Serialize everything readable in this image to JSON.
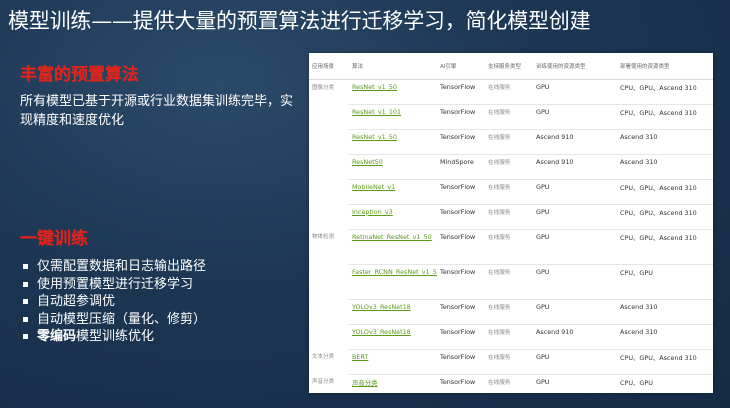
{
  "title": "模型训练——提供大量的预置算法进行迁移学习，简化模型创建",
  "section1": {
    "heading": "丰富的预置算法",
    "description": "所有模型已基于开源或行业数据集训练完毕，实现精度和速度优化"
  },
  "section2": {
    "heading": "一键训练",
    "bullets": [
      {
        "text": "仅需配置数据和日志输出路径"
      },
      {
        "text": "使用预置模型进行迁移学习"
      },
      {
        "text": "自动超参调优"
      },
      {
        "text": "自动模型压缩（量化、修剪）"
      },
      {
        "bold": "零编码",
        "text": "模型训练优化"
      }
    ]
  },
  "table": {
    "headers": [
      "应用场景",
      "算法",
      "AI引擎",
      "支持服务类型",
      "训练使用的资源类型",
      "部署使用的资源类型"
    ],
    "rows": [
      {
        "scene": "图像分类",
        "algo": "ResNet_v1_50",
        "engine": "TensorFlow",
        "service": "在线服务",
        "train": "GPU",
        "deploy": "CPU、GPU、Ascend 310"
      },
      {
        "scene": "",
        "algo": "ResNet_v1_101",
        "engine": "TensorFlow",
        "service": "在线服务",
        "train": "GPU",
        "deploy": "CPU、GPU、Ascend 310"
      },
      {
        "scene": "",
        "algo": "ResNet_v1_50",
        "engine": "TensorFlow",
        "service": "在线服务",
        "train": "Ascend 910",
        "deploy": "Ascend 310"
      },
      {
        "scene": "",
        "algo": "ResNet50",
        "engine": "MindSpore",
        "service": "在线服务",
        "train": "Ascend 910",
        "deploy": "Ascend 310"
      },
      {
        "scene": "",
        "algo": "MobileNet_v1",
        "engine": "TensorFlow",
        "service": "在线服务",
        "train": "GPU",
        "deploy": "CPU、GPU、Ascend 310"
      },
      {
        "scene": "",
        "algo": "Inception_v3",
        "engine": "TensorFlow",
        "service": "在线服务",
        "train": "GPU",
        "deploy": "CPU、GPU、Ascend 310"
      },
      {
        "scene": "物体检测",
        "algo": "RetinaNet_ResNet_v1_50",
        "engine": "TensorFlow",
        "service": "在线服务",
        "train": "GPU",
        "deploy": "CPU、GPU、Ascend 310"
      },
      {
        "scene": "",
        "algo": "Faster_RCNN_ResNet_v1_50",
        "engine": "TensorFlow",
        "service": "在线服务",
        "train": "GPU",
        "deploy": "CPU、GPU"
      },
      {
        "scene": "",
        "algo": "YOLOv3_ResNet18",
        "engine": "TensorFlow",
        "service": "在线服务",
        "train": "GPU",
        "deploy": "Ascend 310"
      },
      {
        "scene": "",
        "algo": "YOLOv3_ResNet18",
        "engine": "TensorFlow",
        "service": "在线服务",
        "train": "Ascend 910",
        "deploy": "Ascend 310"
      },
      {
        "scene": "文本分类",
        "algo": "BERT",
        "engine": "TensorFlow",
        "service": "在线服务",
        "train": "GPU",
        "deploy": "CPU、GPU、Ascend 310"
      },
      {
        "scene": "声音分类",
        "algo": "声音分类",
        "engine": "TensorFlow",
        "service": "在线服务",
        "train": "GPU",
        "deploy": "CPU、GPU"
      }
    ]
  },
  "colors": {
    "accent_red": "#e2231a",
    "link_green": "#5b9a1a",
    "background": "#1c3653"
  }
}
